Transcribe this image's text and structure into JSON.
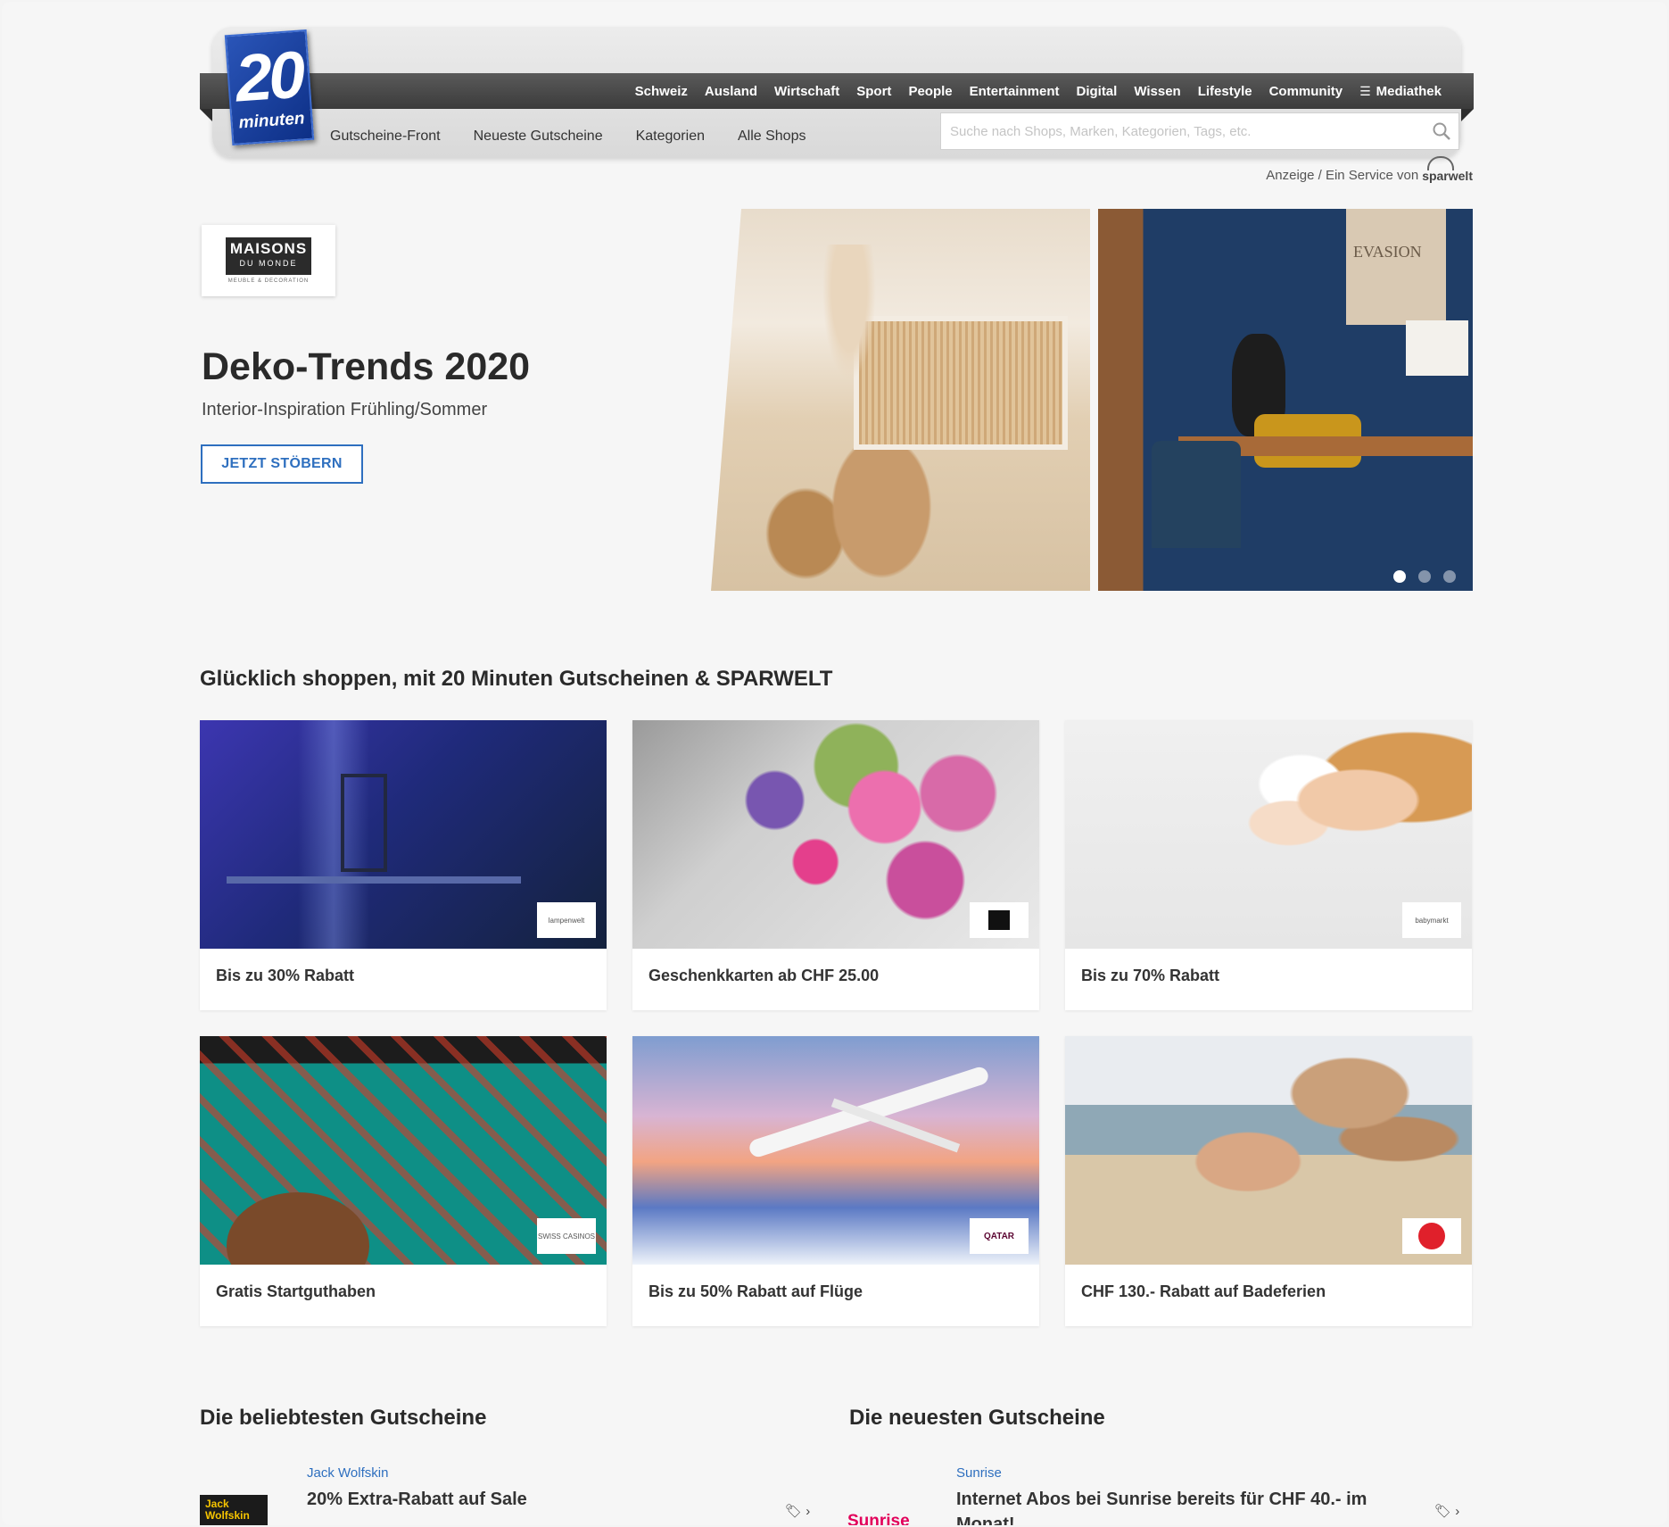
{
  "header": {
    "logo_number": "20",
    "logo_word": "minuten",
    "nav_items": [
      "Schweiz",
      "Ausland",
      "Wirtschaft",
      "Sport",
      "People",
      "Entertainment",
      "Digital",
      "Wissen",
      "Lifestyle",
      "Community"
    ],
    "mediathek_label": "Mediathek",
    "subnav_items": [
      "Gutscheine-Front",
      "Neueste Gutscheine",
      "Kategorien",
      "Alle Shops"
    ],
    "search_placeholder": "Suche nach Shops, Marken, Kategorien, Tags, etc.",
    "anzeige_text": "Anzeige / Ein Service von",
    "sparwelt_logo": "sparwelt"
  },
  "hero": {
    "brand_line1": "MAISONS",
    "brand_line2": "DU MONDE",
    "brand_tagline": "MEUBLE & DECORATION",
    "title": "Deko-Trends 2020",
    "subtitle": "Interior-Inspiration Frühling/Sommer",
    "cta_label": "JETZT STÖBERN",
    "poster_text": "EVASION",
    "slide_count": 3,
    "active_slide": 1
  },
  "section": {
    "title": "Glücklich shoppen, mit 20 Minuten Gutscheinen & SPARWELT",
    "cards": [
      {
        "label": "Bis zu 30% Rabatt",
        "badge": "lampenwelt"
      },
      {
        "label": "Geschenkkarten ab CHF 25.00",
        "badge": ""
      },
      {
        "label": "Bis zu 70% Rabatt",
        "badge": "babymarkt"
      },
      {
        "label": "Gratis Startguthaben",
        "badge": "SWISS CASINOS"
      },
      {
        "label": "Bis zu 50% Rabatt auf Flüge",
        "badge": "QATAR"
      },
      {
        "label": "CHF 130.- Rabatt auf Badeferien",
        "badge": ""
      }
    ]
  },
  "popular": {
    "title": "Die beliebtesten Gutscheine",
    "logo_text": "Jack Wolfskin",
    "shop": "Jack Wolfskin",
    "offer": "20% Extra-Rabatt auf Sale"
  },
  "newest": {
    "title": "Die neuesten Gutscheine",
    "logo_text": "Sunrise",
    "shop": "Sunrise",
    "offer": "Internet Abos bei Sunrise bereits für CHF 40.- im Monat!"
  },
  "colors": {
    "accent_blue": "#2e6fbf",
    "logo_blue": "#0d2f86",
    "nav_bar": "#3b3b3b",
    "sunrise_pink": "#e2005a"
  }
}
